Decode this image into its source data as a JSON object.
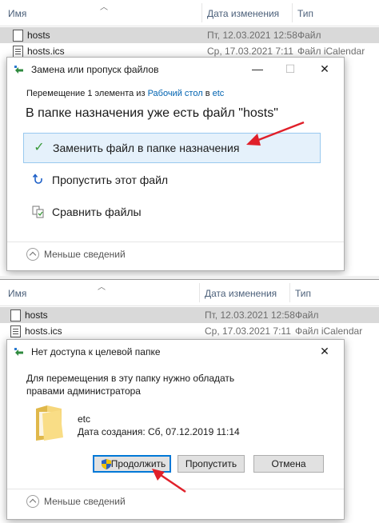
{
  "explorer": {
    "columns": {
      "name": "Имя",
      "date": "Дата изменения",
      "type": "Тип"
    },
    "files": [
      {
        "name": "hosts",
        "date": "Пт, 12.03.2021 12:58",
        "type": "Файл"
      },
      {
        "name": "hosts.ics",
        "date": "Ср, 17.03.2021 7:11",
        "type": "Файл iCalendar"
      }
    ]
  },
  "replace_dialog": {
    "title": "Замена или пропуск файлов",
    "move_prefix": "Перемещение 1 элемента из",
    "source": "Рабочий стол",
    "move_to": "в",
    "destination": "etc",
    "heading": "В папке назначения уже есть файл \"hosts\"",
    "options": [
      {
        "label": "Заменить файл в папке назначения"
      },
      {
        "label": "Пропустить этот файл"
      },
      {
        "label": "Сравнить файлы"
      }
    ],
    "less_details": "Меньше сведений"
  },
  "access_dialog": {
    "title": "Нет доступа к целевой папке",
    "message": "Для перемещения в эту папку нужно обладать правами администратора",
    "folder_name": "etc",
    "folder_date": "Дата создания: Сб, 07.12.2019 11:14",
    "buttons": {
      "continue": "Продолжить",
      "skip": "Пропустить",
      "cancel": "Отмена"
    },
    "less_details": "Меньше сведений"
  },
  "colors": {
    "accent": "#0078d7",
    "link": "#0063b1",
    "highlight_bg": "#e5f1fb",
    "check": "#3a9a3a",
    "arrow": "#e0202a"
  }
}
